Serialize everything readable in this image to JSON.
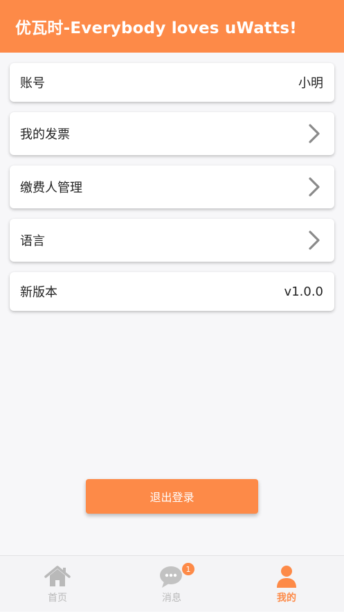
{
  "header": {
    "title": "优瓦时-Everybody loves uWatts!"
  },
  "rows": {
    "account": {
      "label": "账号",
      "value": "小明"
    },
    "invoice": {
      "label": "我的发票",
      "icon": "chevron-right-icon"
    },
    "payer": {
      "label": "缴费人管理",
      "icon": "chevron-right-icon"
    },
    "language": {
      "label": "语言",
      "icon": "chevron-right-icon"
    },
    "version": {
      "label": "新版本",
      "value": "v1.0.0"
    }
  },
  "logout_label": "退出登录",
  "tabbar": {
    "home": {
      "label": "首页",
      "icon": "home-icon"
    },
    "messages": {
      "label": "消息",
      "icon": "chat-bubble-icon",
      "badge": "1"
    },
    "mine": {
      "label": "我的",
      "icon": "person-icon",
      "active": true
    }
  },
  "colors": {
    "accent": "#fd8a48",
    "inactive": "#b9b9b9",
    "background": "#f7f7f9"
  }
}
